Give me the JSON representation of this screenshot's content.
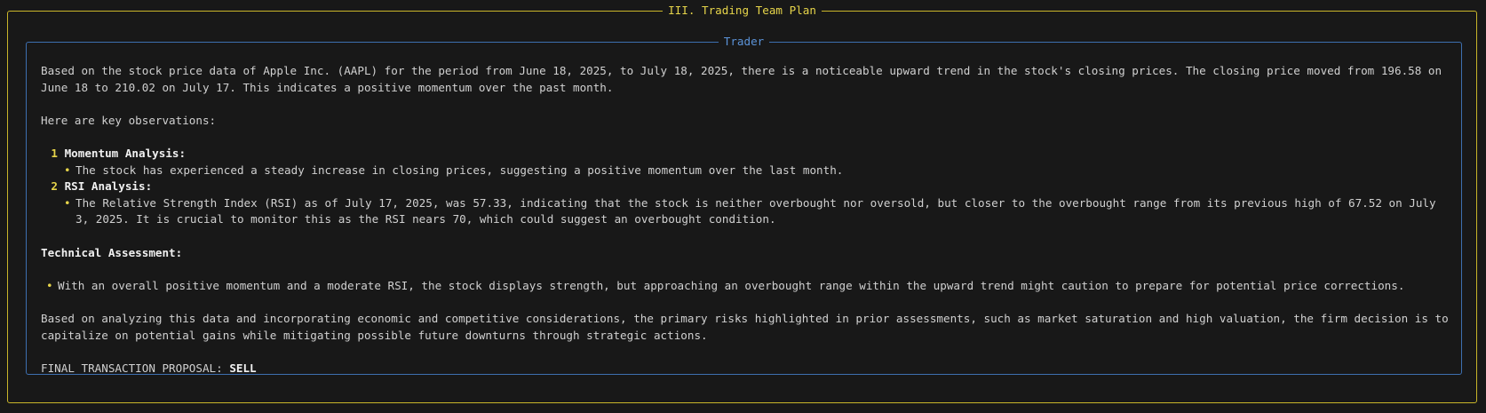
{
  "outer_panel": {
    "title": "III. Trading Team Plan"
  },
  "inner_panel": {
    "title": "Trader",
    "intro": "Based on the stock price data of Apple Inc. (AAPL) for the period from June 18, 2025, to July 18, 2025, there is a noticeable upward trend in the stock's closing prices. The closing price moved from 196.58 on June 18 to 210.02 on July 17. This indicates a positive momentum over the past month.",
    "observations_heading": "Here are key observations:",
    "numbered_items": [
      {
        "number": "1",
        "label": "Momentum Analysis:",
        "bullet": "The stock has experienced a steady increase in closing prices, suggesting a positive momentum over the last month."
      },
      {
        "number": "2",
        "label": "RSI Analysis:",
        "bullet": "The Relative Strength Index (RSI) as of July 17, 2025, was 57.33, indicating that the stock is neither overbought nor oversold, but closer to the overbought range from its previous high of 67.52 on July 3, 2025. It is crucial to monitor this as the RSI nears 70, which could suggest an overbought condition."
      }
    ],
    "technical_heading": "Technical Assessment:",
    "technical_bullet": "With an overall positive momentum and a moderate RSI, the stock displays strength, but approaching an overbought range within the upward trend might caution to prepare for potential price corrections.",
    "conclusion": "Based on analyzing this data and incorporating economic and competitive considerations, the primary risks highlighted in prior assessments, such as market saturation and high valuation, the firm decision is to capitalize on potential gains while mitigating possible future downturns through strategic actions.",
    "final_label": "FINAL TRANSACTION PROPOSAL:",
    "final_value": "SELL"
  },
  "icons": {
    "bullet": "•"
  },
  "colors": {
    "outer_border": "#c9b52a",
    "outer_title": "#e6d44a",
    "inner_border": "#3d6fb0",
    "inner_title": "#5b93d8",
    "accent": "#e6d44a",
    "background": "#181818",
    "text": "#d0d0d0"
  }
}
